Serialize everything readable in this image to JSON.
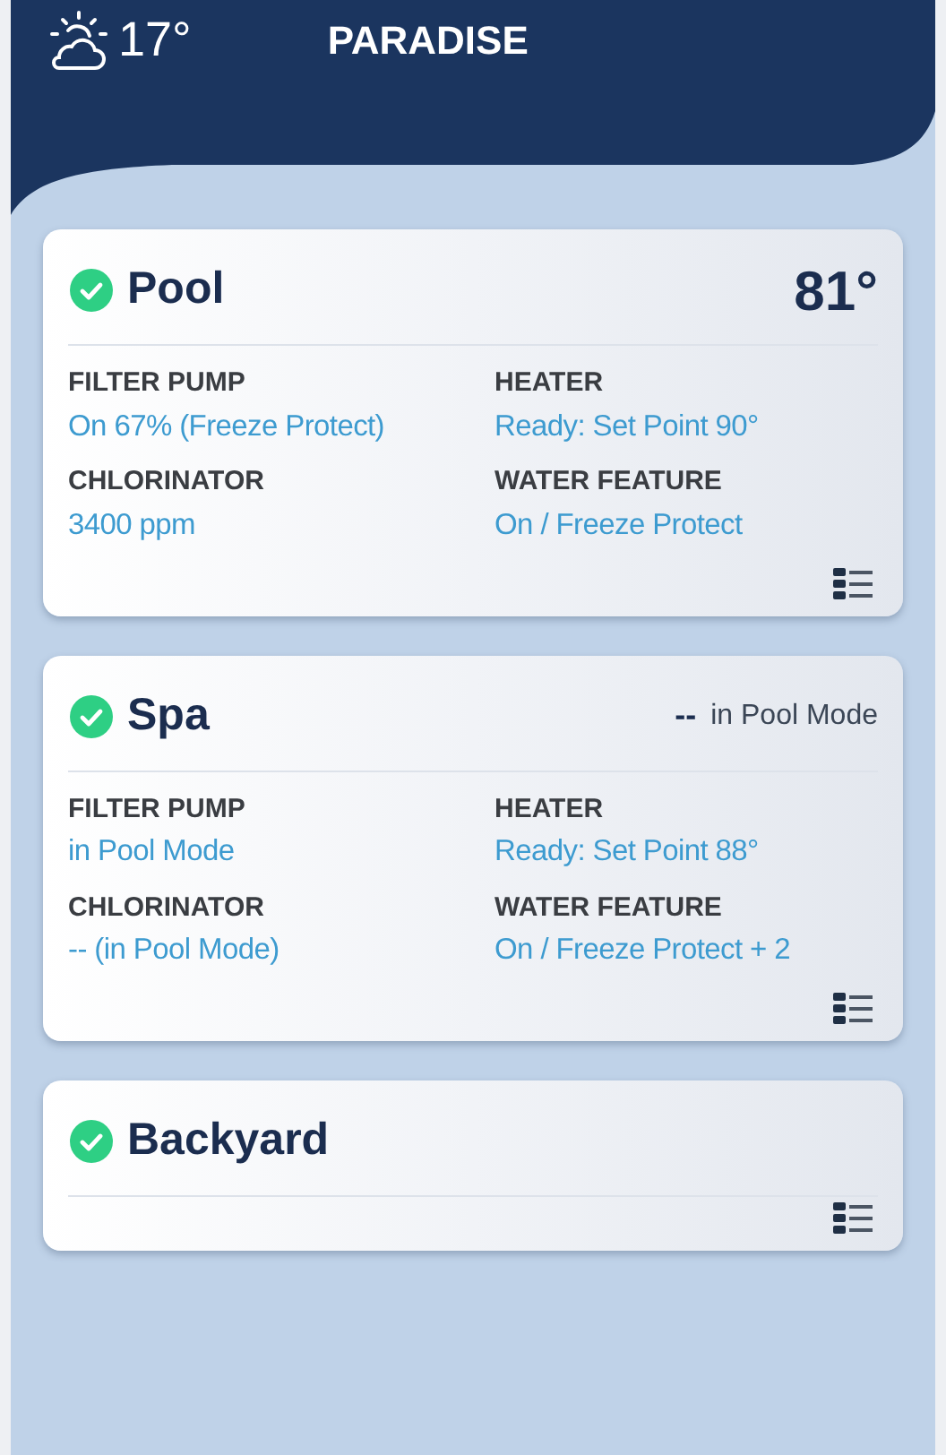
{
  "header": {
    "temperature": "17°",
    "title": "PARADISE"
  },
  "bodies": [
    {
      "name": "Pool",
      "ok": true,
      "reading": {
        "kind": "temp",
        "value": "81°"
      },
      "fields": [
        {
          "label": "FILTER PUMP",
          "value": "On 67% (Freeze Protect)"
        },
        {
          "label": "HEATER",
          "value": "Ready: Set Point 90°"
        },
        {
          "label": "CHLORINATOR",
          "value": "3400 ppm"
        },
        {
          "label": "WATER FEATURE",
          "value": "On / Freeze Protect"
        }
      ]
    },
    {
      "name": "Spa",
      "ok": true,
      "reading": {
        "kind": "note",
        "value": "--",
        "note": "in Pool Mode"
      },
      "fields": [
        {
          "label": "FILTER PUMP",
          "value": "in Pool Mode"
        },
        {
          "label": "HEATER",
          "value": "Ready: Set Point 88°"
        },
        {
          "label": "CHLORINATOR",
          "value": "-- (in Pool Mode)"
        },
        {
          "label": "WATER FEATURE",
          "value": "On / Freeze Protect + 2"
        }
      ]
    },
    {
      "name": "Backyard",
      "ok": true
    }
  ]
}
